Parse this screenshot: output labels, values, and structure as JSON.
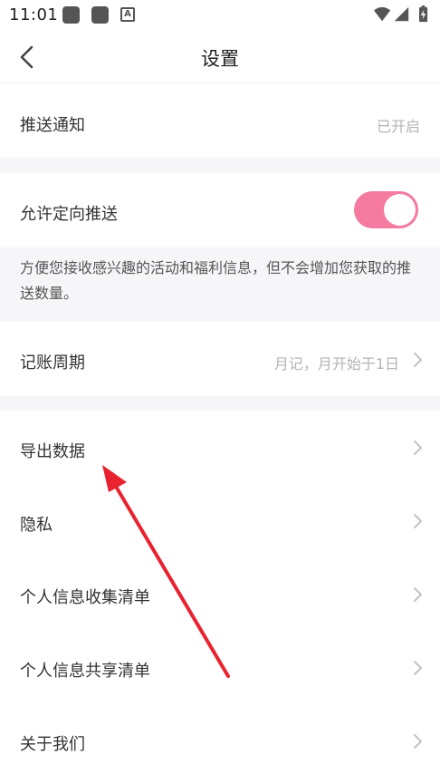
{
  "status_bar": {
    "time": "11:01"
  },
  "header": {
    "title": "设置"
  },
  "settings": {
    "push_notification": {
      "label": "推送通知",
      "value": "已开启"
    },
    "targeted_push": {
      "label": "允许定向推送",
      "enabled": true,
      "toggle_color": "#f47a9f",
      "description": "方便您接收感兴趣的活动和福利信息，但不会增加您获取的推送数量。"
    },
    "billing_cycle": {
      "label": "记账周期",
      "value": "月记，月开始于1日"
    },
    "items": [
      {
        "label": "导出数据"
      },
      {
        "label": "隐私"
      },
      {
        "label": "个人信息收集清单"
      },
      {
        "label": "个人信息共享清单"
      },
      {
        "label": "关于我们"
      }
    ]
  },
  "annotation": {
    "arrow_color": "#e8232f"
  }
}
